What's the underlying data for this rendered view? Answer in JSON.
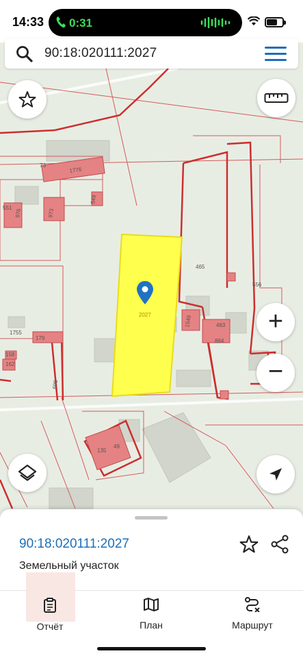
{
  "status_bar": {
    "time": "14:33",
    "call_timer": "0:31",
    "battery_level": 0.7
  },
  "search": {
    "query": "90:18:020111:2027",
    "search_icon": "search-icon",
    "menu_icon": "hamburger-menu-icon"
  },
  "map": {
    "parcel_labels": [
      "73",
      "1776",
      "551",
      "976",
      "973",
      "549",
      "465",
      "556",
      "2027",
      "1755",
      "179",
      "158",
      "162",
      "463",
      "864",
      "1549",
      "695",
      "135",
      "49"
    ],
    "selected_parcel": "2027",
    "parcel_fill": "#ffff4d",
    "boundary_color": "#cc2e2e",
    "building_color": "#e28181"
  },
  "controls": {
    "favorite": "star-icon",
    "ruler": "ruler-icon",
    "zoom_in": "+",
    "zoom_out": "−",
    "layers": "layers-icon",
    "locate": "navigation-arrow-icon"
  },
  "sheet": {
    "title": "90:18:020111:2027",
    "subtitle": "Земельный участок",
    "tabs": [
      {
        "label": "Отчёт",
        "icon": "clipboard-icon"
      },
      {
        "label": "План",
        "icon": "map-icon"
      },
      {
        "label": "Маршрут",
        "icon": "route-icon"
      }
    ],
    "accent": "#1d6fb8"
  }
}
